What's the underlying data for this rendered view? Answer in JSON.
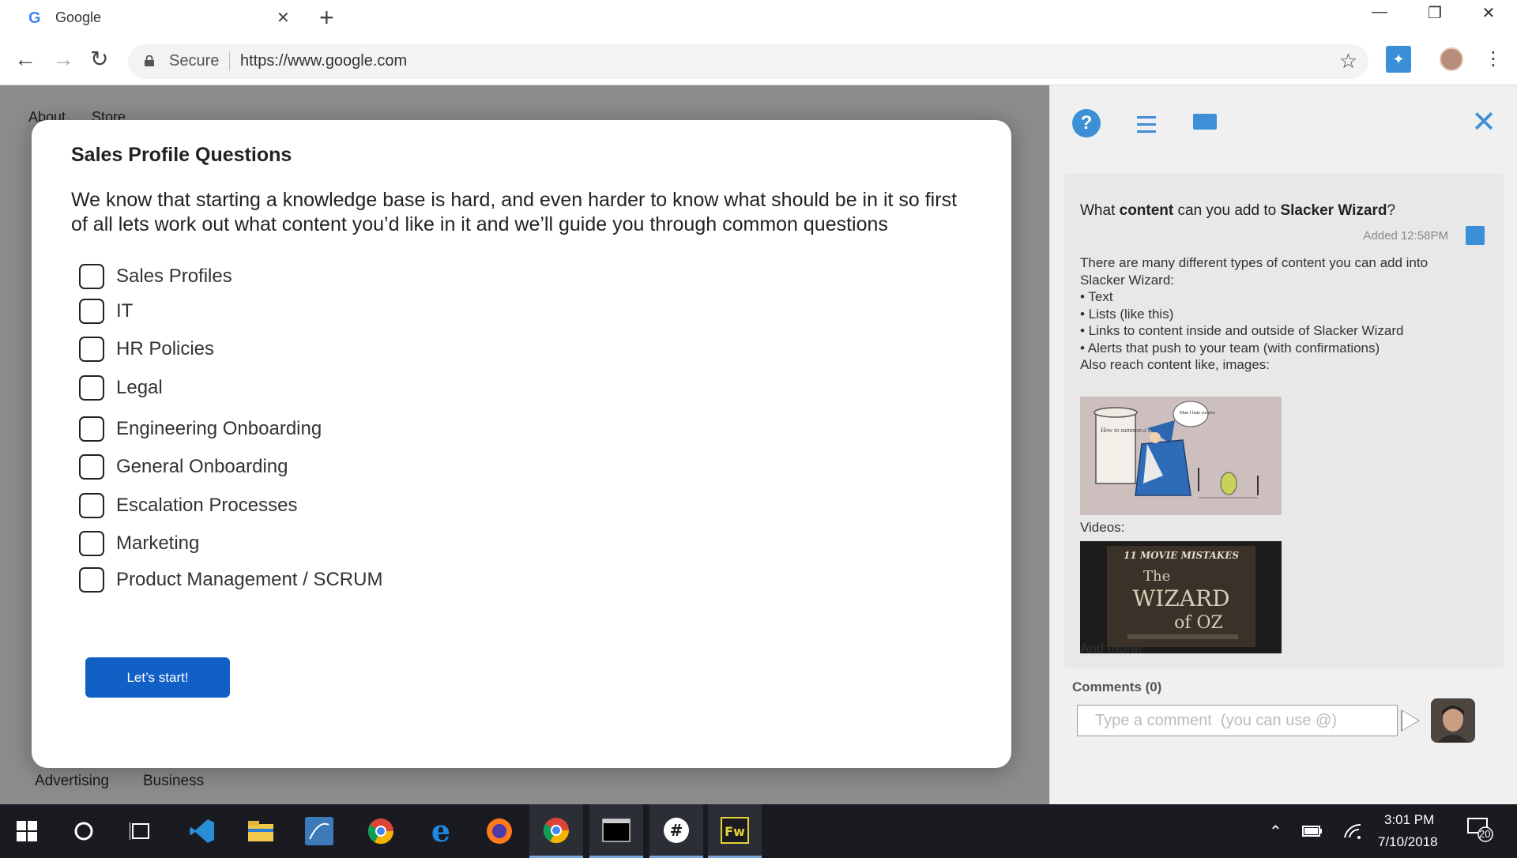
{
  "browser": {
    "tab_title": "Google",
    "favicon_glyph": "G",
    "secure_label": "Secure",
    "url": "https://www.google.com"
  },
  "google_page": {
    "top_links": [
      "About",
      "Store"
    ],
    "footer_links": [
      "Advertising",
      "Business"
    ]
  },
  "modal": {
    "title": "Sales Profile Questions",
    "intro": "We know that starting a knowledge base is hard, and even harder to know what should be in it so first of all lets work out what content you’d like in it and we’ll guide you through common questions",
    "options": [
      "Sales Profiles",
      "IT",
      "HR Policies",
      "Legal",
      "Engineering Onboarding",
      "General Onboarding",
      "Escalation Processes",
      "Marketing",
      "Product Management / SCRUM"
    ],
    "start_button": "Let’s start!"
  },
  "panel": {
    "question_prefix": "What ",
    "question_bold1": "content",
    "question_mid": " can you add to ",
    "question_bold2": "Slacker Wizard",
    "question_suffix": "?",
    "added": "Added 12:58PM",
    "body_lines": [
      "There are many different types of content you can add into",
      "Slacker Wizard:",
      "• Text",
      "• Lists (like this)",
      "• Links to content inside and outside of Slacker Wizard",
      "• Alerts that push to your team (with confirmations)",
      "Also reach content like, images:"
    ],
    "image_text": {
      "scroll": "How to summon a demon",
      "speech": "Man I hate cursive"
    },
    "videos_label": "Videos:",
    "video_text": {
      "top": "11 MOVIE MISTAKES",
      "the": "The",
      "wizard": "WIZARD",
      "of_oz": "of OZ"
    },
    "more_label": "And more!",
    "comments_label": "Comments (0)",
    "comment_placeholder": "Type a comment  (you can use @)"
  },
  "taskbar": {
    "time": "3:01 PM",
    "date": "7/10/2018",
    "notification_count": "20",
    "apps": [
      "windows-start",
      "cortana",
      "task-view",
      "vscode",
      "file-explorer",
      "sql-tool",
      "chrome-dev",
      "edge",
      "firefox",
      "chrome",
      "terminal",
      "slack",
      "fireworks"
    ]
  },
  "colors": {
    "accent": "#1160c5",
    "panel_blue": "#3d8fd6"
  }
}
